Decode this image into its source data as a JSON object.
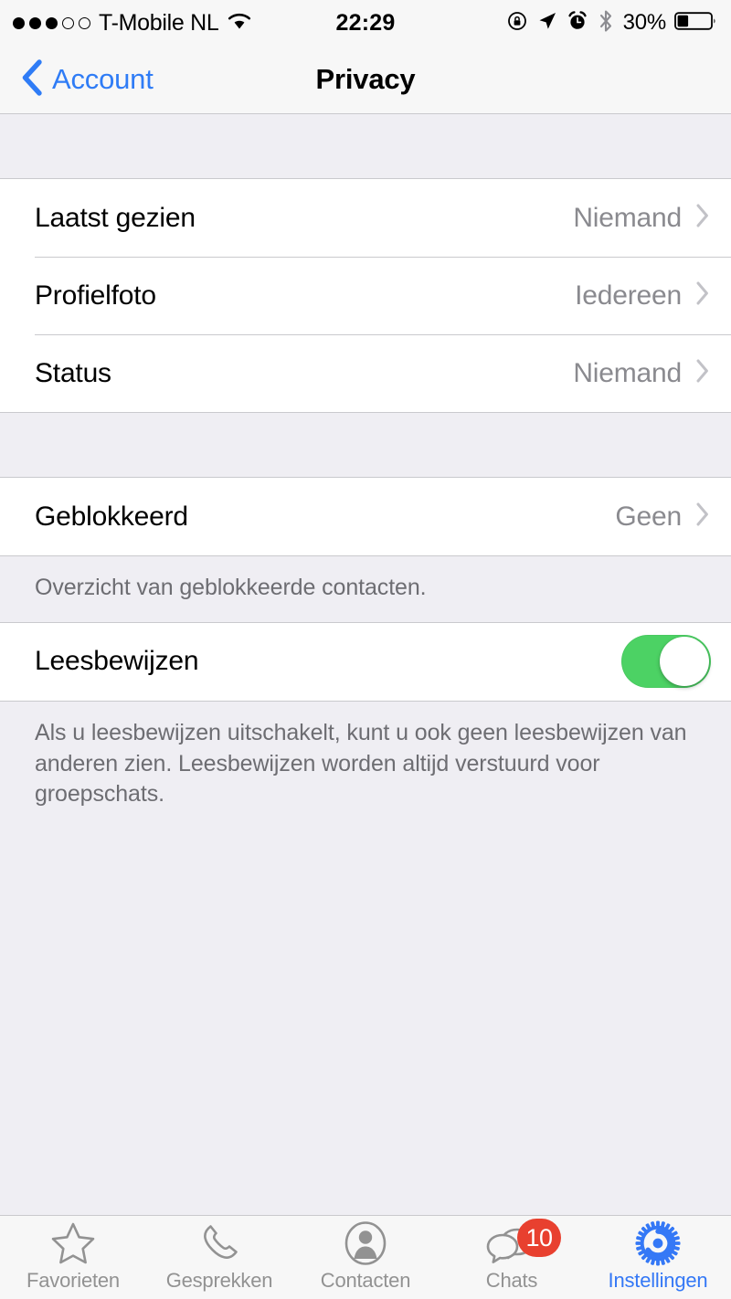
{
  "status_bar": {
    "signal_dots_filled": 3,
    "signal_dots_total": 5,
    "carrier": "T-Mobile NL",
    "wifi_icon": "wifi-icon",
    "time": "22:29",
    "icons": [
      "rotation-lock-icon",
      "location-arrow-icon",
      "alarm-clock-icon",
      "bluetooth-icon"
    ],
    "battery_percent": "30%",
    "battery_level": 30
  },
  "nav": {
    "back_label": "Account",
    "back_icon": "chevron-left-icon",
    "title": "Privacy"
  },
  "sections": {
    "visibility": {
      "rows": [
        {
          "label": "Laatst gezien",
          "value": "Niemand",
          "accessory": "chevron-right-icon"
        },
        {
          "label": "Profielfoto",
          "value": "Iedereen",
          "accessory": "chevron-right-icon"
        },
        {
          "label": "Status",
          "value": "Niemand",
          "accessory": "chevron-right-icon"
        }
      ]
    },
    "blocked": {
      "row": {
        "label": "Geblokkeerd",
        "value": "Geen",
        "accessory": "chevron-right-icon"
      },
      "note": "Overzicht van geblokkeerde contacten."
    },
    "read_receipts": {
      "row": {
        "label": "Leesbewijzen",
        "toggle_on": true
      },
      "note": "Als u leesbewijzen uitschakelt, kunt u ook geen leesbewijzen van anderen zien. Leesbewijzen worden altijd verstuurd voor groepschats."
    }
  },
  "tab_bar": {
    "tabs": [
      {
        "label": "Favorieten",
        "icon": "star-icon",
        "active": false
      },
      {
        "label": "Gesprekken",
        "icon": "phone-icon",
        "active": false
      },
      {
        "label": "Contacten",
        "icon": "person-circle-icon",
        "active": false
      },
      {
        "label": "Chats",
        "icon": "chat-bubbles-icon",
        "active": false,
        "badge": "10"
      },
      {
        "label": "Instellingen",
        "icon": "gear-icon",
        "active": true
      }
    ]
  },
  "colors": {
    "accent_blue": "#3478F6",
    "toggle_green": "#4CD264",
    "badge_red": "#E8402F",
    "value_gray": "#8A8A8F",
    "background": "#EFEEF3"
  }
}
